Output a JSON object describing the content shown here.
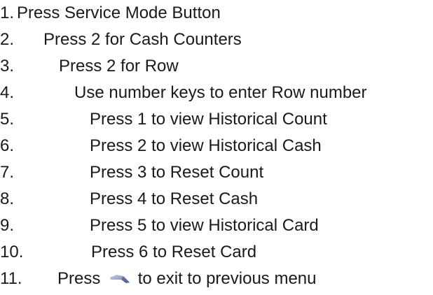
{
  "steps": [
    {
      "number": "1.",
      "text": "Press Service Mode Button"
    },
    {
      "number": "2.",
      "text": "Press 2 for Cash Counters"
    },
    {
      "number": "3.",
      "text": "Press 2 for Row"
    },
    {
      "number": "4.",
      "text": "Use number keys to enter Row number"
    },
    {
      "number": "5.",
      "text": "Press 1 to view Historical Count"
    },
    {
      "number": "6.",
      "text": "Press 2 to view Historical Cash"
    },
    {
      "number": "7.",
      "text": "Press 3 to Reset Count"
    },
    {
      "number": "8.",
      "text": "Press 4 to Reset Cash"
    },
    {
      "number": "9.",
      "text": "Press 5 to view Historical Card"
    },
    {
      "number": "10.",
      "text": "Press 6 to Reset Card"
    },
    {
      "number": "11.",
      "text_before": "Press",
      "icon": "back-arrow-key-icon",
      "text_after": "to exit to previous menu"
    }
  ],
  "colors": {
    "text": "#1a1a1a",
    "icon_light": "#b9c6dd",
    "icon_mid": "#7f93bd",
    "icon_dark": "#3f4f8a"
  }
}
